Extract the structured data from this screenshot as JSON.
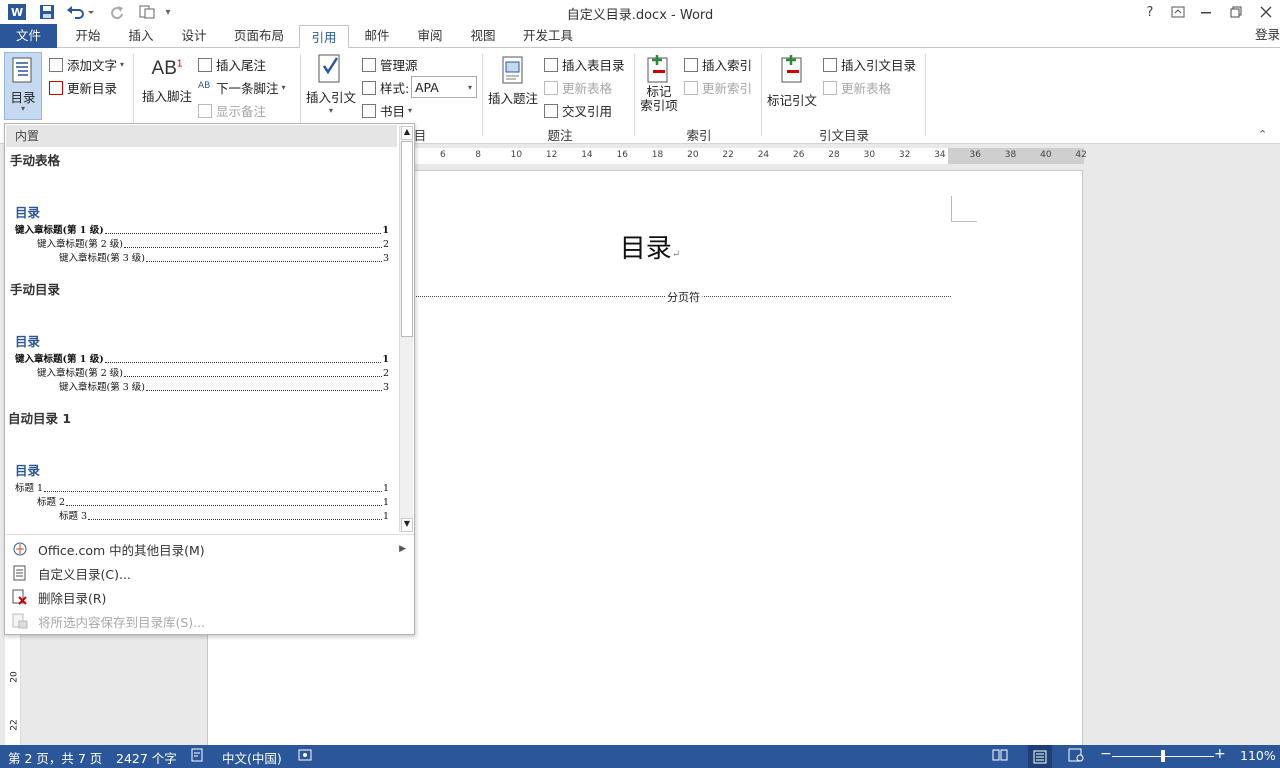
{
  "titlebar": {
    "title": "自定义目录.docx - Word",
    "help": "?",
    "restore_ribbon": "⊡",
    "minimize": "—",
    "maximize": "🗗",
    "close": "✕"
  },
  "tabs": [
    {
      "label": "文件"
    },
    {
      "label": "开始"
    },
    {
      "label": "插入"
    },
    {
      "label": "设计"
    },
    {
      "label": "页面布局"
    },
    {
      "label": "引用"
    },
    {
      "label": "邮件"
    },
    {
      "label": "审阅"
    },
    {
      "label": "视图"
    },
    {
      "label": "开发工具"
    }
  ],
  "signin": "登录",
  "ribbon": {
    "toc_button": "目录",
    "add_text": "添加文字",
    "update_toc": "更新目录",
    "insert_footnote": "插入脚注",
    "insert_endnote": "插入尾注",
    "next_footnote": "下一条脚注",
    "show_notes": "显示备注",
    "insert_citation": "插入引文",
    "manage_sources": "管理源",
    "style_label": "样式:",
    "style_value": "APA",
    "bibliography": "书目",
    "insert_caption": "插入题注",
    "insert_table_of_figures": "插入表目录",
    "update_table": "更新表格",
    "cross_reference": "交叉引用",
    "mark_entry_1": "标记",
    "mark_entry_2": "索引项",
    "insert_index": "插入索引",
    "update_index": "更新索引",
    "mark_citation": "标记引文",
    "insert_table_of_authorities": "插入引文目录",
    "update_authorities": "更新表格",
    "groups": {
      "citations_tail": "目",
      "captions": "题注",
      "index": "索引",
      "authorities": "引文目录"
    }
  },
  "ruler": {
    "ticks": [
      "6",
      "8",
      "10",
      "12",
      "14",
      "16",
      "18",
      "20",
      "22",
      "24",
      "26",
      "28",
      "30",
      "32",
      "34",
      "36",
      "38",
      "40",
      "42"
    ]
  },
  "vruler": {
    "ticks": [
      "20",
      "22"
    ]
  },
  "document": {
    "heading": "目录",
    "page_break": "分页符"
  },
  "gallery": {
    "header": "内置",
    "items": [
      {
        "title": "手动表格",
        "toc_heading": "目录",
        "lines": [
          {
            "text": "键入章标题(第 1 级)",
            "page": "1",
            "bold": true
          },
          {
            "text": "键入章标题(第 2 级)",
            "page": "2",
            "bold": false
          },
          {
            "text": "键入章标题(第 3 级)",
            "page": "3",
            "bold": false
          }
        ]
      },
      {
        "title": "手动目录",
        "toc_heading": "目录",
        "lines": [
          {
            "text": "键入章标题(第 1 级)",
            "page": "1",
            "bold": true
          },
          {
            "text": "键入章标题(第 2 级)",
            "page": "2",
            "bold": false
          },
          {
            "text": "键入章标题(第 3 级)",
            "page": "3",
            "bold": false
          }
        ]
      },
      {
        "title": "自动目录 1",
        "toc_heading": "目录",
        "lines": [
          {
            "text": "标题 1",
            "page": "1",
            "bold": false
          },
          {
            "text": "标题 2",
            "page": "1",
            "bold": false
          },
          {
            "text": "标题 3",
            "page": "1",
            "bold": false
          }
        ]
      }
    ],
    "menu": [
      {
        "label": "Office.com 中的其他目录(M)",
        "enabled": true
      },
      {
        "label": "自定义目录(C)...",
        "enabled": true
      },
      {
        "label": "删除目录(R)",
        "enabled": true
      },
      {
        "label": "将所选内容保存到目录库(S)...",
        "enabled": false
      }
    ]
  },
  "status": {
    "page": "第 2 页，共 7 页",
    "words": "2427 个字",
    "language": "中文(中国)",
    "zoom": "110%"
  }
}
